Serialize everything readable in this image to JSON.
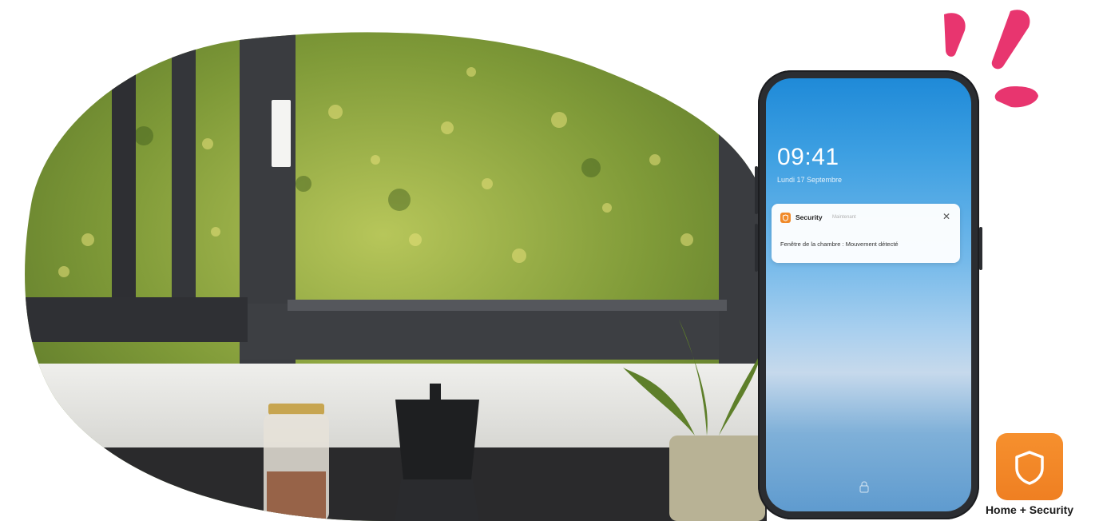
{
  "lockscreen": {
    "time": "09:41",
    "date": "Lundi 17 Septembre"
  },
  "notification": {
    "app_name": "Security",
    "when": "Maintenant",
    "message": "Fenêtre de la chambre : Mouvement détecté",
    "close_symbol": "✕"
  },
  "app": {
    "label": "Home + Security",
    "icon": "shield-icon"
  },
  "colors": {
    "accent_pink": "#e8356f",
    "app_orange": "#f08a2a",
    "phone_frame": "#2b2d31"
  }
}
